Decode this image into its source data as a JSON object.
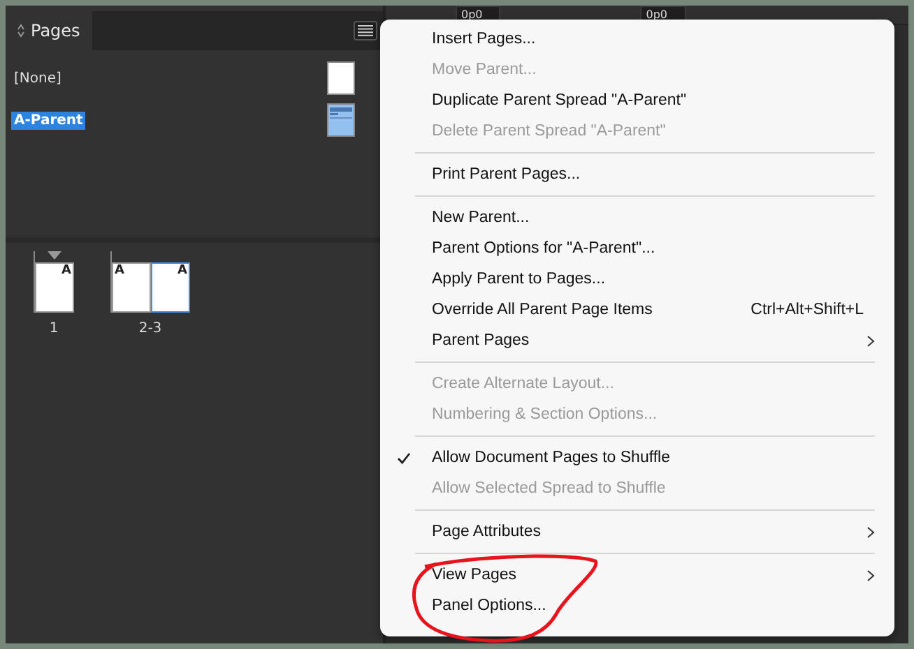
{
  "panel": {
    "tab": {
      "label": "Pages",
      "selected": true
    },
    "parents": [
      {
        "name": "[None]",
        "selected": false,
        "kind": "blank"
      },
      {
        "name": "A-Parent",
        "selected": true,
        "kind": "layout"
      }
    ],
    "spreads": [
      {
        "label": "1",
        "current": true,
        "pages": [
          {
            "parent_prefix": "A",
            "kind": "right",
            "selected": false
          }
        ]
      },
      {
        "label": "2-3",
        "current": false,
        "pages": [
          {
            "parent_prefix": "A",
            "kind": "left",
            "selected": false
          },
          {
            "parent_prefix": "A",
            "kind": "right",
            "selected": true
          }
        ]
      }
    ]
  },
  "toolbar": {
    "fields": [
      "0p0",
      "0p0"
    ]
  },
  "menu": {
    "items": [
      {
        "kind": "item",
        "label": "Insert Pages...",
        "disabled": false
      },
      {
        "kind": "item",
        "label": "Move Parent...",
        "disabled": true
      },
      {
        "kind": "item",
        "label": "Duplicate Parent Spread \"A-Parent\"",
        "disabled": false
      },
      {
        "kind": "item",
        "label": "Delete Parent Spread \"A-Parent\"",
        "disabled": true
      },
      {
        "kind": "separator"
      },
      {
        "kind": "item",
        "label": "Print Parent Pages...",
        "disabled": false
      },
      {
        "kind": "separator"
      },
      {
        "kind": "item",
        "label": "New Parent...",
        "disabled": false
      },
      {
        "kind": "item",
        "label": "Parent Options for \"A-Parent\"...",
        "disabled": false
      },
      {
        "kind": "item",
        "label": "Apply Parent to Pages...",
        "disabled": false
      },
      {
        "kind": "item",
        "label": "Override All Parent Page Items",
        "disabled": false,
        "shortcut": "Ctrl+Alt+Shift+L"
      },
      {
        "kind": "item",
        "label": "Parent Pages",
        "disabled": false,
        "submenu": true
      },
      {
        "kind": "separator"
      },
      {
        "kind": "item",
        "label": "Create Alternate Layout...",
        "disabled": true
      },
      {
        "kind": "item",
        "label": "Numbering & Section Options...",
        "disabled": true
      },
      {
        "kind": "separator"
      },
      {
        "kind": "item",
        "label": "Allow Document Pages to Shuffle",
        "disabled": false,
        "checked": true
      },
      {
        "kind": "item",
        "label": "Allow Selected Spread to Shuffle",
        "disabled": true
      },
      {
        "kind": "separator"
      },
      {
        "kind": "item",
        "label": "Page Attributes",
        "disabled": false,
        "submenu": true
      },
      {
        "kind": "separator"
      },
      {
        "kind": "item",
        "label": "View Pages",
        "disabled": false,
        "submenu": true
      },
      {
        "kind": "item",
        "label": "Panel Options...",
        "disabled": false
      }
    ]
  }
}
